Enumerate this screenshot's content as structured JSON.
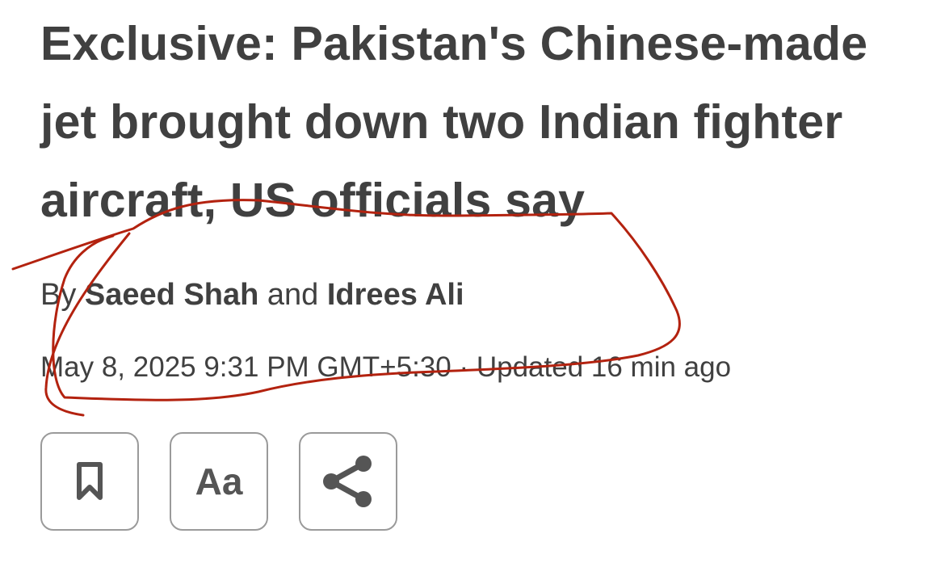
{
  "article": {
    "headline": "Exclusive: Pakistan's Chinese-made jet brought down two Indian fighter aircraft, US officials say",
    "byline": {
      "prefix": "By",
      "author_1": "Saeed Shah",
      "joiner": "and",
      "author_2": "Idrees Ali"
    },
    "dateline": "May 8, 2025 9:31 PM GMT+5:30 · Updated 16 min ago"
  },
  "actions": {
    "bookmark_icon": "bookmark-icon",
    "text_size_label": "Aa",
    "share_icon": "share-icon"
  },
  "colors": {
    "text": "#404040",
    "button_border": "#9a9a9a",
    "icon": "#555555",
    "annotation_stroke": "#b3220f"
  }
}
